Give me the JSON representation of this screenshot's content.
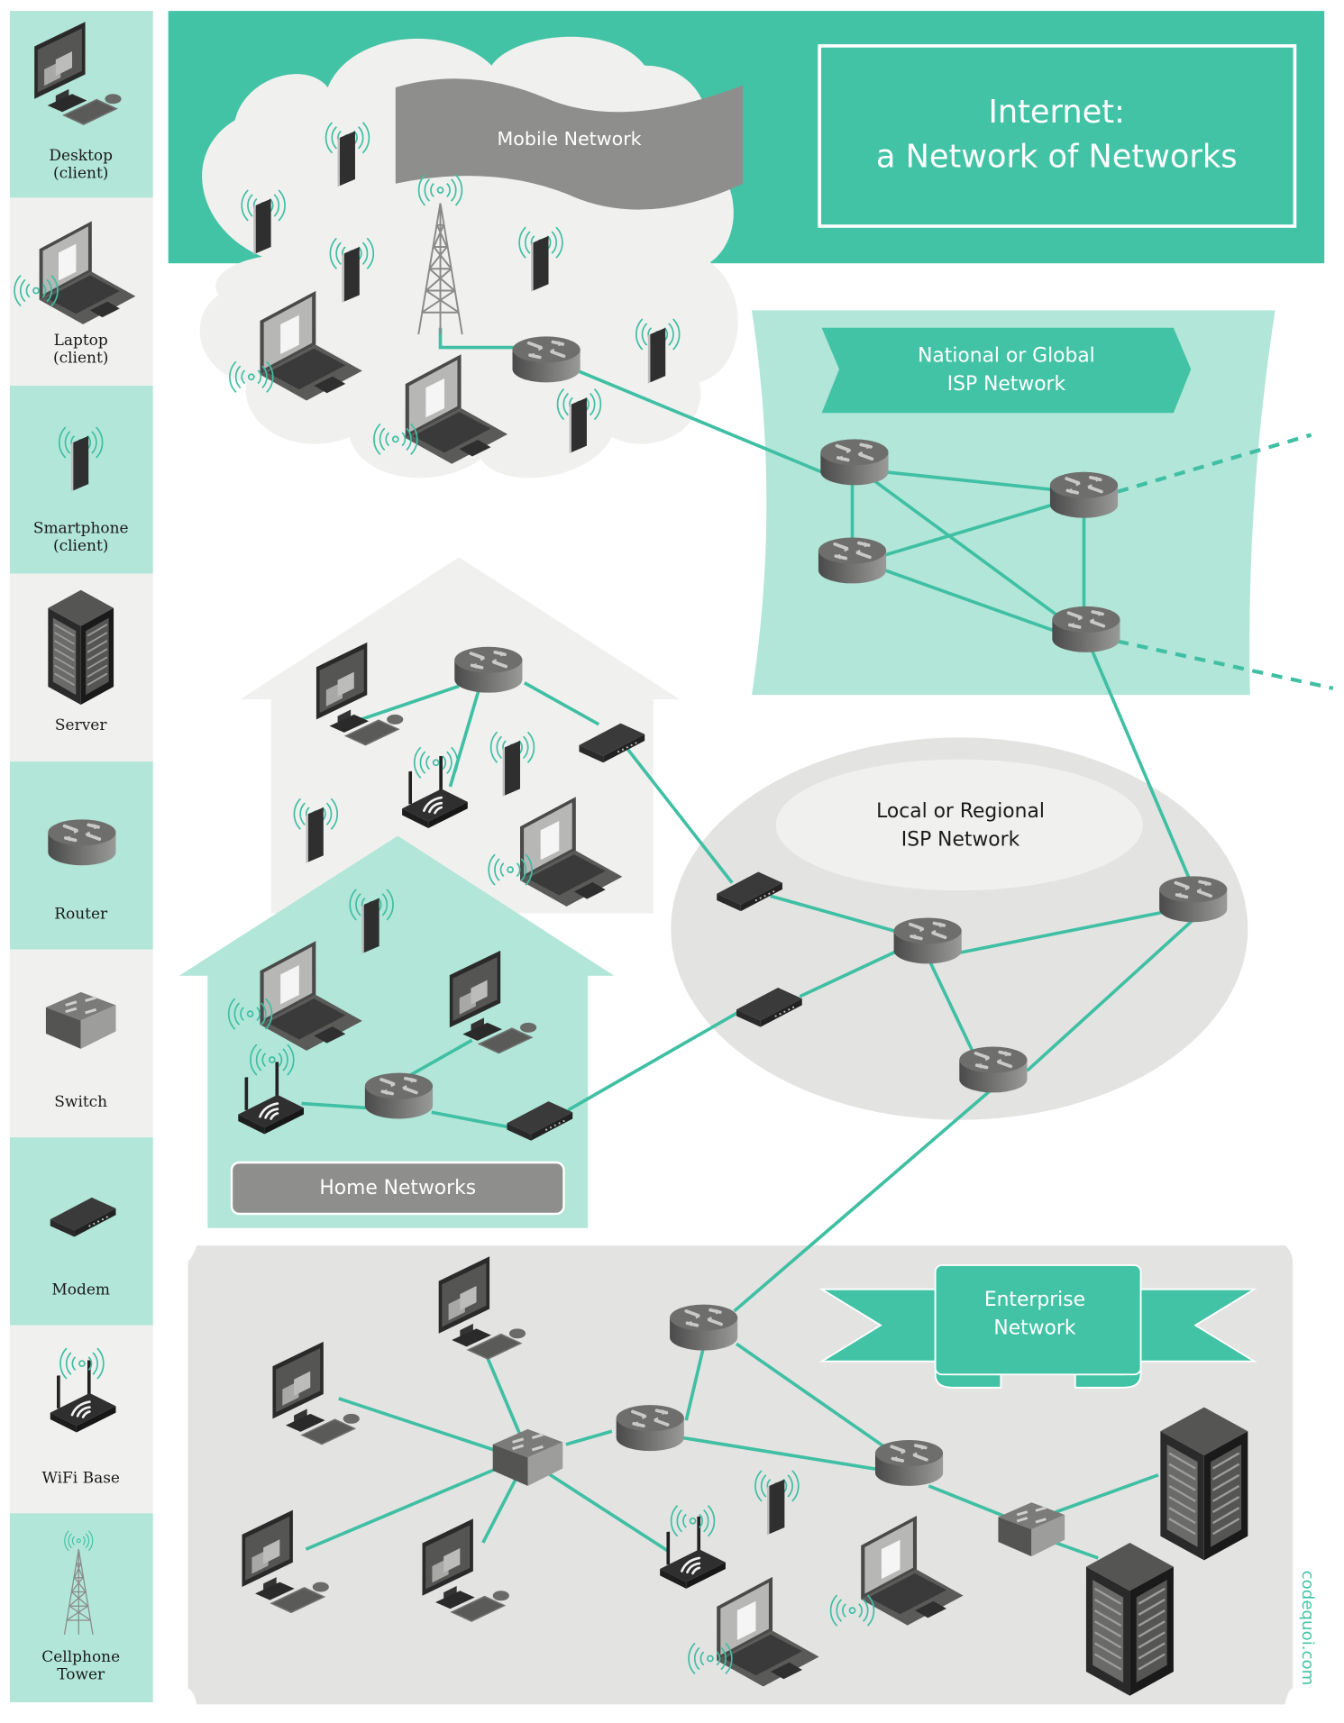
{
  "colors": {
    "teal": "#43c3a5",
    "teal_light": "#b2e6d8",
    "gray_light": "#f0f0ef",
    "gray_mid": "#e3e3e2",
    "label_gray": "#8e8f8c",
    "device_dark": "#3d3d3d",
    "white": "#ffffff",
    "text_dark": "#1a1a1a"
  },
  "header": {
    "title_line1": "Internet:",
    "title_line2": "a Network of Networks"
  },
  "legend": {
    "items": [
      {
        "icon": "desktop-icon",
        "label_line1": "Desktop",
        "label_line2": "(client)"
      },
      {
        "icon": "laptop-icon",
        "label_line1": "Laptop",
        "label_line2": "(client)"
      },
      {
        "icon": "smartphone-icon",
        "label_line1": "Smartphone",
        "label_line2": "(client)"
      },
      {
        "icon": "server-icon",
        "label_line1": "Server",
        "label_line2": ""
      },
      {
        "icon": "router-icon",
        "label_line1": "Router",
        "label_line2": ""
      },
      {
        "icon": "switch-icon",
        "label_line1": "Switch",
        "label_line2": ""
      },
      {
        "icon": "modem-icon",
        "label_line1": "Modem",
        "label_line2": ""
      },
      {
        "icon": "wifi-base-icon",
        "label_line1": "WiFi Base",
        "label_line2": ""
      },
      {
        "icon": "cellphone-tower-icon",
        "label_line1": "Cellphone",
        "label_line2": "Tower"
      }
    ]
  },
  "networks": {
    "mobile": {
      "label": "Mobile Network"
    },
    "national": {
      "label_line1": "National or Global",
      "label_line2": "ISP Network"
    },
    "local": {
      "label_line1": "Local or Regional",
      "label_line2": "ISP Network"
    },
    "home": {
      "label": "Home Networks"
    },
    "enterprise": {
      "label_line1": "Enterprise",
      "label_line2": "Network"
    }
  },
  "credit": "codequoi.com"
}
